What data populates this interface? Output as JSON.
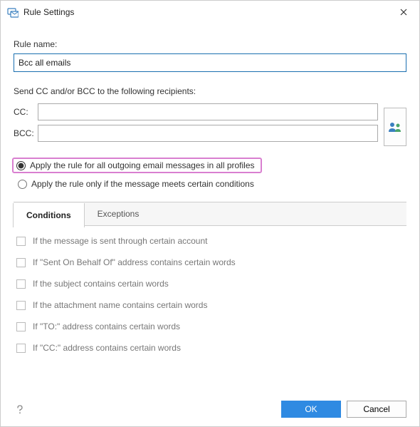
{
  "window": {
    "title": "Rule Settings"
  },
  "ruleName": {
    "label": "Rule name:",
    "value": "Bcc all emails"
  },
  "recipients": {
    "heading": "Send CC and/or BCC to the following recipients:",
    "ccLabel": "CC:",
    "ccValue": "",
    "bccLabel": "BCC:",
    "bccValue": ""
  },
  "scope": {
    "allLabel": "Apply the rule for all outgoing email messages in all profiles",
    "condLabel": "Apply the rule only if the message meets certain conditions",
    "selected": "all"
  },
  "tabs": {
    "conditions": "Conditions",
    "exceptions": "Exceptions",
    "active": "conditions"
  },
  "conditions": [
    "If the message is sent through certain account",
    "If \"Sent On Behalf Of\" address contains certain words",
    "If the subject contains certain words",
    "If the attachment name contains certain words",
    "If \"TO:\" address contains certain words",
    "If \"CC:\" address contains certain words"
  ],
  "buttons": {
    "ok": "OK",
    "cancel": "Cancel"
  }
}
